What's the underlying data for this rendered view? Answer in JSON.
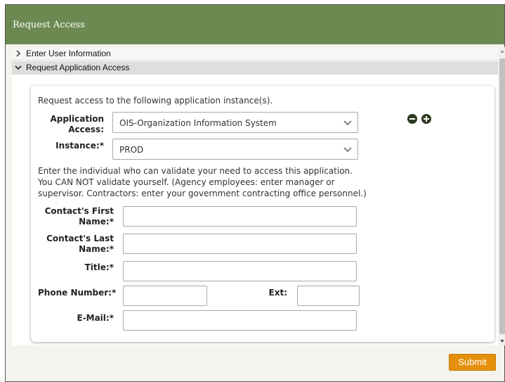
{
  "window": {
    "title": "Request Access"
  },
  "accordion": {
    "sections": [
      {
        "label": "Enter User Information",
        "state": "collapsed"
      },
      {
        "label": "Request Application Access",
        "state": "expanded"
      }
    ]
  },
  "form": {
    "intro": "Request access to the following application instance(s).",
    "application": {
      "label_line1": "Application",
      "label_line2": "Access:",
      "value": "OIS-Organization Information System"
    },
    "instance": {
      "label": "Instance:*",
      "value": "PROD"
    },
    "validator_note": "Enter the individual who can validate your need to access this application. You CAN NOT validate yourself. (Agency employees: enter manager or supervisor. Contractors: enter your government contracting office personnel.)",
    "contact_first": {
      "label_line1": "Contact's First",
      "label_line2": "Name:*",
      "value": ""
    },
    "contact_last": {
      "label_line1": "Contact's Last",
      "label_line2": "Name:*",
      "value": ""
    },
    "title": {
      "label": "Title:*",
      "value": ""
    },
    "phone": {
      "label": "Phone Number:*",
      "value": ""
    },
    "ext": {
      "label": "Ext:",
      "value": ""
    },
    "email": {
      "label": "E-Mail:*",
      "value": ""
    }
  },
  "actions": {
    "submit_label": "Submit"
  },
  "icons": {
    "remove": "minus-circle-icon",
    "add": "plus-circle-icon",
    "collapsed_chevron": "chevron-right-icon",
    "expanded_chevron": "chevron-down-icon"
  },
  "colors": {
    "header": "#6b8950",
    "submit": "#e5900c",
    "icon": "#2e3a22"
  }
}
